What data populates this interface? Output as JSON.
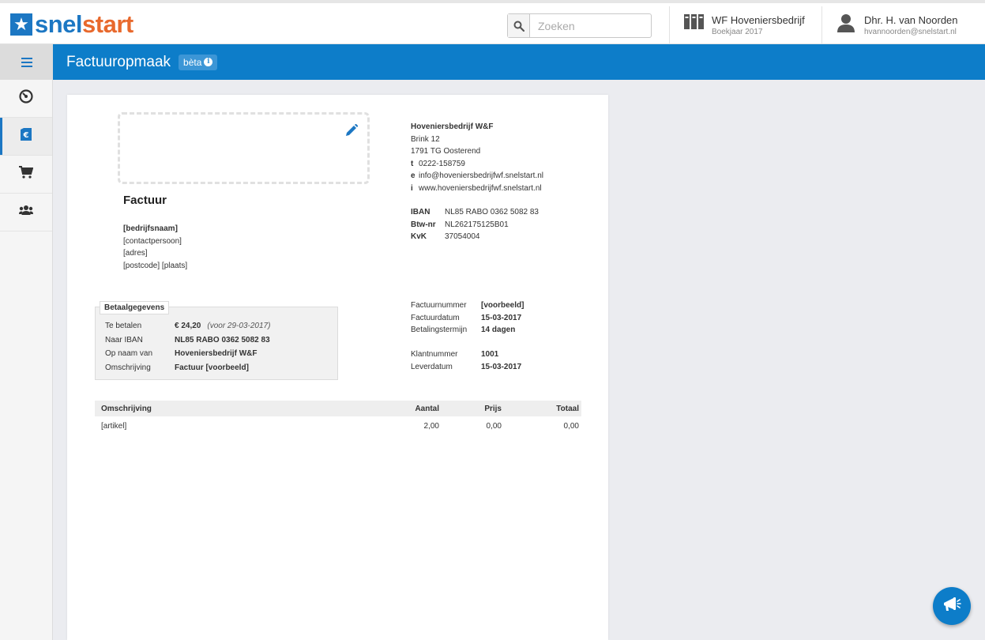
{
  "brand": {
    "part1": "snel",
    "part2": "start",
    "star": "★"
  },
  "search": {
    "placeholder": "Zoeken"
  },
  "company_switch": {
    "name": "WF Hoveniersbedrijf",
    "year": "Boekjaar 2017"
  },
  "user": {
    "name": "Dhr. H. van Noorden",
    "email": "hvannoorden@snelstart.nl"
  },
  "sidebar": {
    "items": [
      {
        "icon": "dashboard-icon"
      },
      {
        "icon": "invoice-icon"
      },
      {
        "icon": "cart-icon"
      },
      {
        "icon": "users-icon"
      }
    ]
  },
  "header": {
    "title": "Factuuropmaak",
    "badge": "bèta",
    "badge_info": "i"
  },
  "invoice": {
    "title": "Factuur",
    "recipient": {
      "company": "[bedrijfsnaam]",
      "contact": "[contactpersoon]",
      "address": "[adres]",
      "postcode_city": "[postcode] [plaats]"
    },
    "sender": {
      "name": "Hoveniersbedrijf W&F",
      "street": "Brink 12",
      "city": "1791 TG Oosterend",
      "phone_key": "t",
      "phone": "0222-158759",
      "email_key": "e",
      "email": "info@hoveniersbedrijfwf.snelstart.nl",
      "web_key": "i",
      "web": "www.hoveniersbedrijfwf.snelstart.nl",
      "iban_key": "IBAN",
      "iban": "NL85 RABO 0362 5082 83",
      "btw_key": "Btw-nr",
      "btw": "NL262175125B01",
      "kvk_key": "KvK",
      "kvk": "37054004"
    },
    "payment": {
      "heading": "Betaalgegevens",
      "rows": [
        {
          "label": "Te betalen",
          "value": "€ 24,20",
          "note": "(voor 29-03-2017)"
        },
        {
          "label": "Naar IBAN",
          "value": "NL85 RABO 0362 5082 83"
        },
        {
          "label": "Op naam van",
          "value": "Hoveniersbedrijf W&F"
        },
        {
          "label": "Omschrijving",
          "value": "Factuur [voorbeeld]"
        }
      ]
    },
    "meta": {
      "rows": [
        {
          "label": "Factuurnummer",
          "value": "[voorbeeld]"
        },
        {
          "label": "Factuurdatum",
          "value": "15-03-2017"
        },
        {
          "label": "Betalingstermijn",
          "value": "14 dagen"
        },
        {
          "label": "Klantnummer",
          "value": "1001"
        },
        {
          "label": "Leverdatum",
          "value": "15-03-2017"
        }
      ]
    },
    "lines": {
      "headers": {
        "desc": "Omschrijving",
        "aantal": "Aantal",
        "prijs": "Prijs",
        "totaal": "Totaal"
      },
      "rows": [
        {
          "desc": "[artikel]",
          "aantal": "2,00",
          "prijs": "0,00",
          "totaal": "0,00"
        }
      ]
    }
  },
  "colors": {
    "brand_blue": "#1c77c3",
    "brand_orange": "#e8692d",
    "header_blue": "#0d7dc9"
  }
}
